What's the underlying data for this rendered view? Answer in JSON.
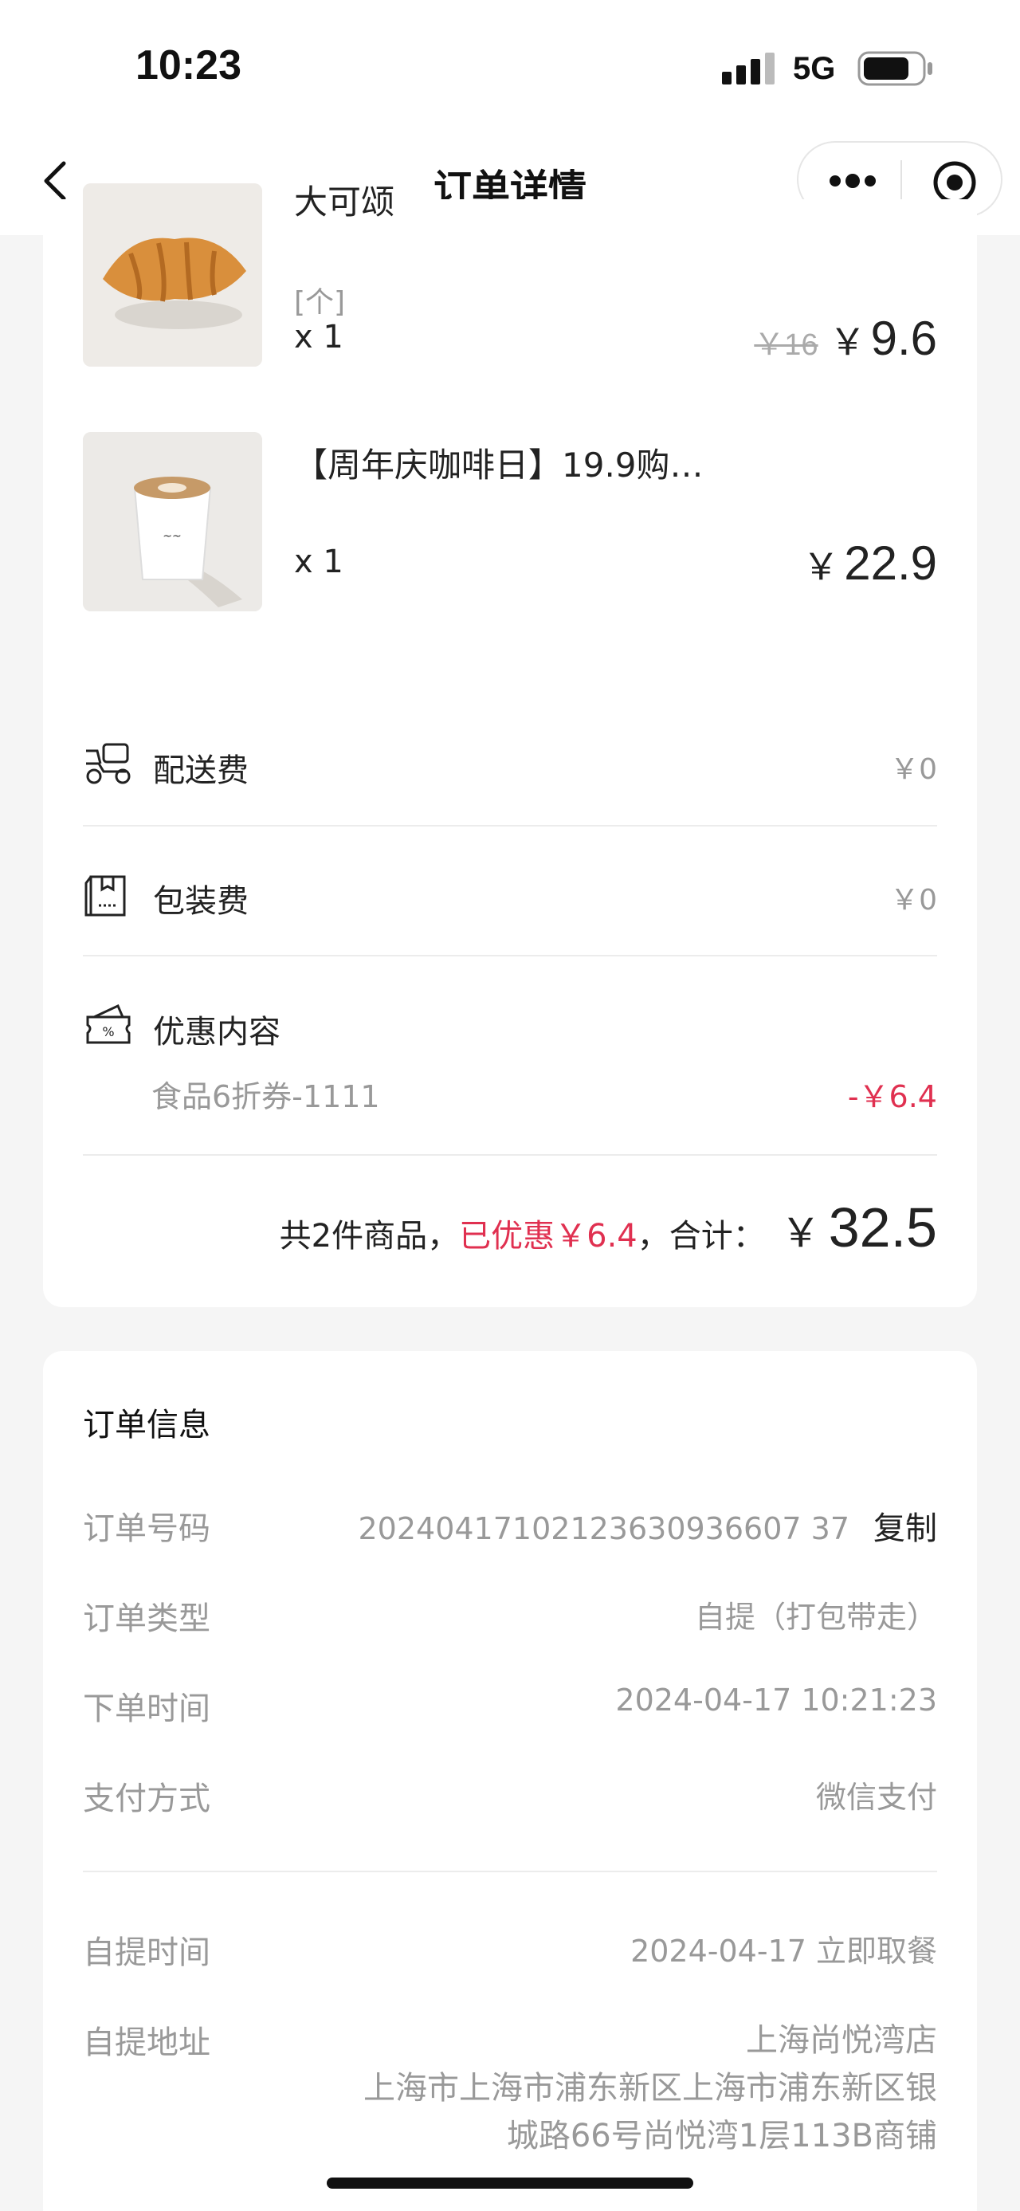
{
  "status_bar": {
    "time": "10:23",
    "network": "5G"
  },
  "nav": {
    "title": "订单详情"
  },
  "products": [
    {
      "name": "大可颂",
      "spec": "[个]",
      "qty": "x 1",
      "orig_price": "￥16",
      "yen": "￥",
      "price": "9.6"
    },
    {
      "name": "【周年庆咖啡日】19.9购…",
      "qty": "x 1",
      "yen": "￥",
      "price": "22.9"
    }
  ],
  "fees": {
    "delivery_label": "配送费",
    "delivery_value": "￥0",
    "packaging_label": "包装费",
    "packaging_value": "￥0",
    "discount_label": "优惠内容",
    "discount_name": "食品6折券-1111",
    "discount_value": "-￥6.4"
  },
  "summary": {
    "count_text": "共2件商品，",
    "saved_text": "已优惠￥6.4",
    "total_label": "，合计：",
    "yen": "￥",
    "total": "32.5"
  },
  "order_info": {
    "title": "订单信息",
    "order_no_label": "订单号码",
    "order_no": "20240417102123630936607 37",
    "copy_label": "复制",
    "type_label": "订单类型",
    "type_value": "自提（打包带走）",
    "time_label": "下单时间",
    "time_value": "2024-04-17 10:21:23",
    "pay_label": "支付方式",
    "pay_value": "微信支付",
    "pickup_time_label": "自提时间",
    "pickup_time_value": "2024-04-17 立即取餐",
    "pickup_addr_label": "自提地址",
    "pickup_store": "上海尚悦湾店",
    "pickup_addr_line1": "上海市上海市浦东新区上海市浦东新区银",
    "pickup_addr_line2": "城路66号尚悦湾1层113B商铺"
  },
  "colors": {
    "accent_red": "#e03050",
    "muted": "#999999"
  }
}
